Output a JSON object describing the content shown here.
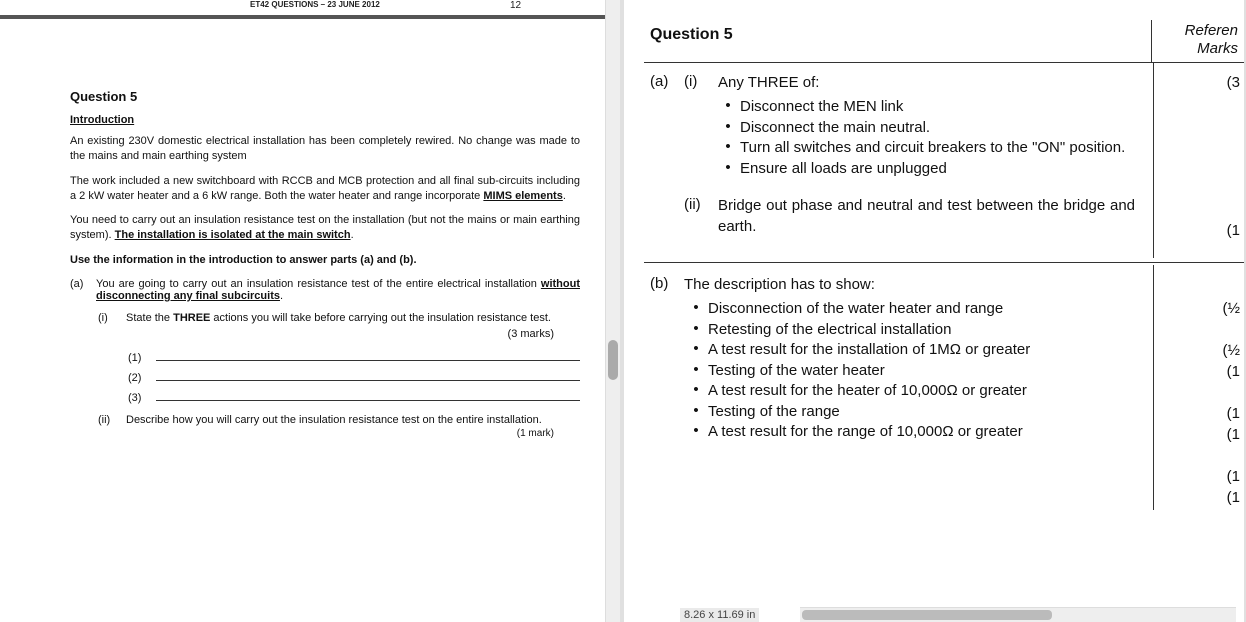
{
  "left": {
    "header": "ET42 QUESTIONS – 23 JUNE 2012",
    "page_number": "12",
    "title": "Question 5",
    "intro_heading": "Introduction",
    "p1": "An existing 230V domestic electrical installation has been completely rewired. No change was made to the mains and main earthing system",
    "p2_a": "The work included a new switchboard with RCCB and MCB protection and all final sub-circuits including a 2 kW water heater and a 6 kW range.  Both the water heater and range incorporate ",
    "p2_b_u": "MIMS elements",
    "p2_c": ".",
    "p3_a": "You need to carry out an insulation resistance test on the installation (but not the mains or main earthing system).  ",
    "p3_b_u": "The installation is isolated at the main switch",
    "p3_c": ".",
    "p4": "Use the information in the introduction to answer parts (a) and (b).",
    "a_label": "(a)",
    "a_text_a": "You are going to carry out an insulation resistance test of the entire electrical installation ",
    "a_text_u": "without disconnecting any final subcircuits",
    "a_text_c": ".",
    "a_i_label": "(i)",
    "a_i_text_a": "State the ",
    "a_i_text_b": "THREE",
    "a_i_text_c": " actions you will take before carrying out the insulation resistance test.",
    "a_i_marks": "(3 marks)",
    "blank1": "(1)",
    "blank2": "(2)",
    "blank3": "(3)",
    "a_ii_label": "(ii)",
    "a_ii_text": "Describe how you will carry out the insulation resistance test on the entire installation.",
    "a_ii_marks": "(1 mark)"
  },
  "right": {
    "hdr_left": "Question 5",
    "hdr_refer": "Referen",
    "hdr_marks": "Marks",
    "a_label": "(a)",
    "i_label": "(i)",
    "i_lead": "Any THREE of:",
    "i_bullets": [
      "Disconnect the MEN link",
      "Disconnect the main neutral.",
      "Turn all switches and circuit breakers to the \"ON\" position.",
      "Ensure all loads are unplugged"
    ],
    "i_mark": "(3",
    "ii_label": "(ii)",
    "ii_text": "Bridge out phase and neutral and test between the bridge and earth.",
    "ii_mark": "(1",
    "b_label": "(b)",
    "b_lead": "The description has to show:",
    "b_bullets": [
      "Disconnection of the water heater and range",
      "Retesting of the electrical installation",
      "A test result for the installation of 1MΩ or greater",
      "Testing of the water heater",
      "A test result for the heater of 10,000Ω or greater",
      "Testing of the range",
      "A test result for the range of 10,000Ω or greater"
    ],
    "b_marks": [
      "(½",
      "(½",
      "(1",
      "(1",
      "(1",
      "(1",
      "(1"
    ]
  },
  "status": {
    "dim": "8.26 x 11.69 in"
  }
}
